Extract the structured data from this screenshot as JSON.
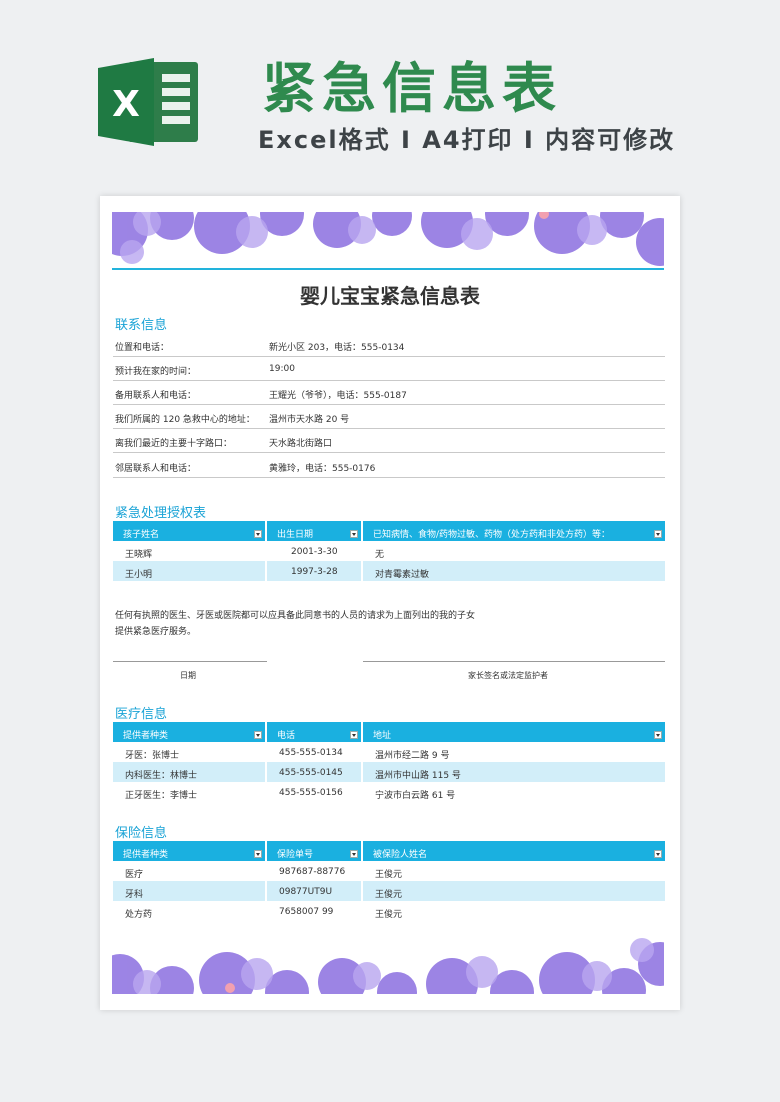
{
  "header": {
    "logo_letter": "X",
    "title": "紧急信息表",
    "subtitle": "Excel格式 I A4打印 I 内容可修改"
  },
  "doc": {
    "title": "婴儿宝宝紧急信息表"
  },
  "contact": {
    "title": "联系信息",
    "rows": [
      {
        "label": "位置和电话：",
        "value": "新光小区 203，电话：555-0134"
      },
      {
        "label": "预计我在家的时间：",
        "value": "19:00"
      },
      {
        "label": "备用联系人和电话：",
        "value": "王耀光（爷爷），电话：555-0187"
      },
      {
        "label": "我们所属的 120 急救中心的地址：",
        "value": "温州市天水路 20 号"
      },
      {
        "label": "离我们最近的主要十字路口：",
        "value": "天水路北街路口"
      },
      {
        "label": "邻居联系人和电话：",
        "value": "黄雅玲，电话：555-0176"
      }
    ]
  },
  "auth": {
    "title": "紧急处理授权表",
    "headers": [
      "孩子姓名",
      "出生日期",
      "已知病情、食物/药物过敏、药物（处方药和非处方药）等："
    ],
    "rows": [
      [
        "王晓辉",
        "2001-3-30",
        "无"
      ],
      [
        "王小明",
        "1997-3-28",
        "对青霉素过敏"
      ]
    ],
    "paragraph": [
      "任何有执照的医生、牙医或医院都可以应具备此同意书的人员的请求为上面列出的我的子女",
      "提供紧急医疗服务。"
    ],
    "sig_date": "日期",
    "sig_parent": "家长签名或法定监护者"
  },
  "medical": {
    "title": "医疗信息",
    "headers": [
      "提供者种类",
      "电话",
      "地址"
    ],
    "rows": [
      [
        "牙医：张博士",
        "455-555-0134",
        "温州市经二路 9 号"
      ],
      [
        "内科医生：林博士",
        "455-555-0145",
        "温州市中山路 115 号"
      ],
      [
        "正牙医生：李博士",
        "455-555-0156",
        "宁波市白云路 61 号"
      ]
    ]
  },
  "insurance": {
    "title": "保险信息",
    "headers": [
      "提供者种类",
      "保险单号",
      "被保险人姓名"
    ],
    "rows": [
      [
        "医疗",
        "987687-88776",
        "王俊元"
      ],
      [
        "牙科",
        "09877UT9U",
        "王俊元"
      ],
      [
        "处方药",
        "7658007 99",
        "王俊元"
      ]
    ]
  },
  "colors": {
    "accent": "#1ab0e0",
    "title_green": "#2f8a4e",
    "row_alt": "#d2eef9",
    "flower": "#7b5cd6"
  }
}
